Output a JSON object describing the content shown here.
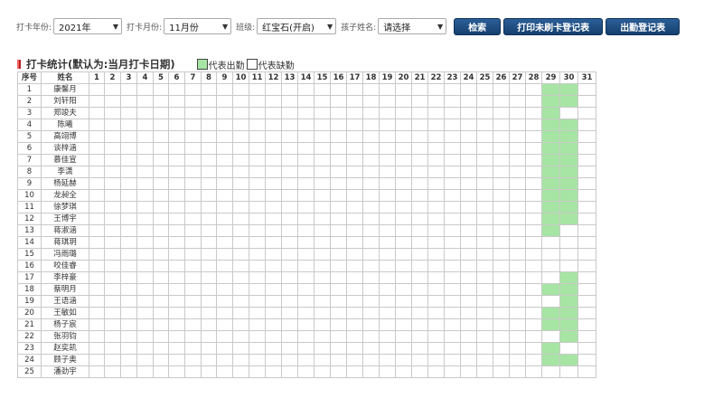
{
  "filters": {
    "year_label": "打卡年份:",
    "year_value": "2021年",
    "month_label": "打卡月份:",
    "month_value": "11月份",
    "class_label": "班级:",
    "class_value": "红宝石(开启)",
    "child_label": "孩子姓名:",
    "child_value": "请选择",
    "search_button": "检索",
    "print_button": "打印未刷卡登记表",
    "attendance_button": "出勤登记表"
  },
  "stats": {
    "title": "打卡统计(默认为:当月打卡日期)",
    "legend_present": "代表出勤",
    "legend_absent": "代表缺勤",
    "present_color": "#a6e5a3"
  },
  "table": {
    "col_index": "序号",
    "col_name": "姓名",
    "days": [
      "1",
      "2",
      "3",
      "4",
      "5",
      "6",
      "7",
      "8",
      "9",
      "10",
      "11",
      "12",
      "13",
      "14",
      "15",
      "16",
      "17",
      "18",
      "19",
      "20",
      "21",
      "22",
      "23",
      "24",
      "25",
      "26",
      "27",
      "28",
      "29",
      "30",
      "31"
    ],
    "rows": [
      {
        "no": "1",
        "name": "康馨月",
        "present": [
          29,
          30
        ]
      },
      {
        "no": "2",
        "name": "刘轩阳",
        "present": [
          29,
          30
        ]
      },
      {
        "no": "3",
        "name": "郑竣夫",
        "present": [
          29
        ]
      },
      {
        "no": "4",
        "name": "陈曦",
        "present": [
          29,
          30
        ]
      },
      {
        "no": "5",
        "name": "高翊博",
        "present": [
          29,
          30
        ]
      },
      {
        "no": "6",
        "name": "谈梓涵",
        "present": [
          29,
          30
        ]
      },
      {
        "no": "7",
        "name": "慕佳宣",
        "present": [
          29,
          30
        ]
      },
      {
        "no": "8",
        "name": "李潇",
        "present": [
          29,
          30
        ]
      },
      {
        "no": "9",
        "name": "杨延赫",
        "present": [
          29,
          30
        ]
      },
      {
        "no": "10",
        "name": "龙昶全",
        "present": [
          29,
          30
        ]
      },
      {
        "no": "11",
        "name": "徐梦琪",
        "present": [
          29,
          30
        ]
      },
      {
        "no": "12",
        "name": "王博宇",
        "present": [
          29,
          30
        ]
      },
      {
        "no": "13",
        "name": "蒋淑涵",
        "present": [
          29
        ]
      },
      {
        "no": "14",
        "name": "蒋琪玥",
        "present": []
      },
      {
        "no": "15",
        "name": "冯雨璐",
        "present": []
      },
      {
        "no": "16",
        "name": "咬佳睿",
        "present": []
      },
      {
        "no": "17",
        "name": "李梓豪",
        "present": [
          30
        ]
      },
      {
        "no": "18",
        "name": "蔡明月",
        "present": [
          29,
          30
        ]
      },
      {
        "no": "19",
        "name": "王语涵",
        "present": [
          30
        ]
      },
      {
        "no": "20",
        "name": "王敏如",
        "present": [
          29,
          30
        ]
      },
      {
        "no": "21",
        "name": "杨子宸",
        "present": [
          29,
          30
        ]
      },
      {
        "no": "22",
        "name": "张羽钧",
        "present": [
          30
        ]
      },
      {
        "no": "23",
        "name": "赵奕凯",
        "present": [
          29
        ]
      },
      {
        "no": "24",
        "name": "顾子奥",
        "present": [
          29,
          30
        ]
      },
      {
        "no": "25",
        "name": "潘劲宇",
        "present": []
      }
    ]
  }
}
